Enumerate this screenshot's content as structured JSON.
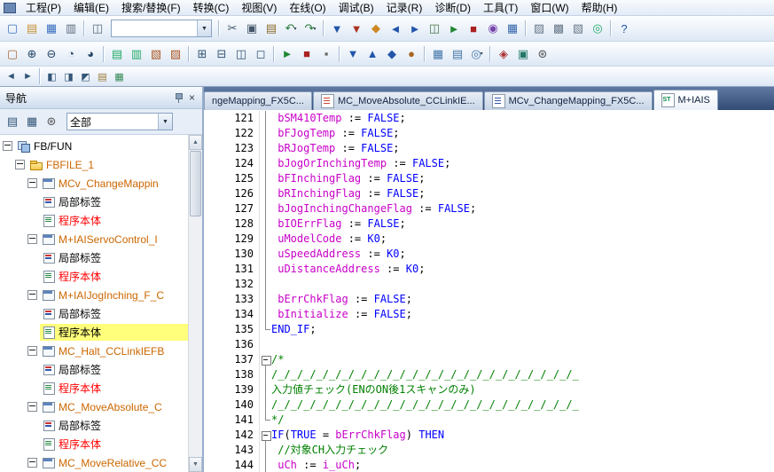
{
  "menubar": {
    "items": [
      "工程(P)",
      "编辑(E)",
      "搜索/替换(F)",
      "转换(C)",
      "视图(V)",
      "在线(O)",
      "调试(B)",
      "记录(R)",
      "诊断(D)",
      "工具(T)",
      "窗口(W)",
      "帮助(H)"
    ]
  },
  "toolbar": {
    "row1": [
      {
        "n": "new-project-icon",
        "g": "▢",
        "c": "#3a6ebf"
      },
      {
        "n": "open-project-icon",
        "g": "▤",
        "c": "#c79138"
      },
      {
        "n": "save-project-icon",
        "g": "▦",
        "c": "#3a6ebf"
      },
      {
        "n": "print-icon",
        "g": "▥",
        "c": "#5a6b7d"
      },
      {
        "s": 1
      },
      {
        "n": "window-switch-icon",
        "g": "◫",
        "c": "#5a6b7d"
      },
      {
        "combo": 1,
        "n": "toolbar-combobox",
        "value": ""
      },
      {
        "s": 1
      },
      {
        "n": "cut-icon",
        "g": "✂",
        "c": "#44566a"
      },
      {
        "n": "copy-icon",
        "g": "▣",
        "c": "#44566a"
      },
      {
        "n": "paste-icon",
        "g": "▤",
        "c": "#8a6a2a"
      },
      {
        "n": "undo-icon",
        "g": "↶",
        "c": "#2a7a3a",
        "dd": 1
      },
      {
        "n": "redo-icon",
        "g": "↷",
        "c": "#2a7a3a",
        "dd": 1
      },
      {
        "s": 1
      },
      {
        "n": "convert-icon",
        "g": "▼",
        "c": "#2255aa"
      },
      {
        "n": "convert-all-icon",
        "g": "▼",
        "c": "#aa3322"
      },
      {
        "n": "online-program-change-icon",
        "g": "◆",
        "c": "#cc8822"
      },
      {
        "n": "read-from-plc-icon",
        "g": "◄",
        "c": "#2255aa"
      },
      {
        "n": "write-to-plc-icon",
        "g": "►",
        "c": "#2255aa"
      },
      {
        "n": "verify-with-plc-icon",
        "g": "◫",
        "c": "#447744"
      },
      {
        "n": "monitor-start-icon",
        "g": "►",
        "c": "#228833"
      },
      {
        "n": "monitor-stop-icon",
        "g": "■",
        "c": "#aa2222"
      },
      {
        "n": "device-test-icon",
        "g": "◉",
        "c": "#7744aa"
      },
      {
        "n": "cross-reference-icon",
        "g": "▦",
        "c": "#3366aa"
      },
      {
        "s": 1
      },
      {
        "n": "device-comment-icon",
        "g": "▨",
        "c": "#667788"
      },
      {
        "n": "statement-display-icon",
        "g": "▩",
        "c": "#667788"
      },
      {
        "n": "note-display-icon",
        "g": "▧",
        "c": "#667788"
      },
      {
        "n": "watch-window-icon",
        "g": "◎",
        "c": "#22aa66"
      },
      {
        "s": 1
      },
      {
        "n": "help-icon",
        "g": "?",
        "c": "#2255aa"
      }
    ],
    "row2": [
      {
        "n": "new-data-icon",
        "g": "▢",
        "c": "#aa6633"
      },
      {
        "n": "zoom-in-icon",
        "g": "⊕",
        "c": "#224466"
      },
      {
        "n": "zoom-out-icon",
        "g": "⊖",
        "c": "#224466"
      },
      {
        "n": "find-icon",
        "g": "◔",
        "c": "#224466"
      },
      {
        "n": "replace-icon",
        "g": "◕",
        "c": "#224466"
      },
      {
        "s": 1
      },
      {
        "n": "comment-display-icon",
        "g": "▤",
        "c": "#22aa66"
      },
      {
        "n": "statement-list-icon",
        "g": "▥",
        "c": "#22aa66"
      },
      {
        "n": "device-display-icon",
        "g": "▧",
        "c": "#aa5522"
      },
      {
        "n": "label-display-icon",
        "g": "▨",
        "c": "#aa5522"
      },
      {
        "s": 1
      },
      {
        "n": "insert-row-icon",
        "g": "⊞",
        "c": "#335577"
      },
      {
        "n": "delete-row-icon",
        "g": "⊟",
        "c": "#335577"
      },
      {
        "n": "insert-column-icon",
        "g": "◫",
        "c": "#335577"
      },
      {
        "n": "delete-column-icon",
        "g": "◻",
        "c": "#335577"
      },
      {
        "s": 1
      },
      {
        "n": "simulation-start-icon",
        "g": "►",
        "c": "#228833"
      },
      {
        "n": "simulation-stop-icon",
        "g": "■",
        "c": "#aa2222"
      },
      {
        "n": "step-execution-icon",
        "g": "▪",
        "c": "#666666"
      },
      {
        "s": 1
      },
      {
        "n": "download-icon",
        "g": "▼",
        "c": "#2255aa"
      },
      {
        "n": "upload-icon",
        "g": "▲",
        "c": "#2255aa"
      },
      {
        "n": "online-verify-icon",
        "g": "◆",
        "c": "#2255aa"
      },
      {
        "n": "remote-operation-icon",
        "g": "●",
        "c": "#aa6622"
      },
      {
        "s": 1
      },
      {
        "n": "cross-reference-list-icon",
        "g": "▦",
        "c": "#4477aa"
      },
      {
        "n": "device-list-icon",
        "g": "▤",
        "c": "#4477aa"
      },
      {
        "n": "watch-register-icon",
        "g": "◎",
        "c": "#4477aa",
        "dd": 1
      },
      {
        "s": 1
      },
      {
        "n": "module-diagnostics-icon",
        "g": "◈",
        "c": "#aa3333"
      },
      {
        "n": "system-monitor-icon",
        "g": "▣",
        "c": "#227766"
      },
      {
        "n": "options-icon",
        "g": "⊛",
        "c": "#555555"
      }
    ],
    "row3": [
      {
        "n": "back-icon",
        "g": "◄",
        "c": "#335577"
      },
      {
        "n": "forward-icon",
        "g": "►",
        "c": "#335577"
      },
      {
        "s": 1
      },
      {
        "n": "docking-window-icon",
        "g": "◧",
        "c": "#335577"
      },
      {
        "n": "element-selection-icon",
        "g": "◨",
        "c": "#335577"
      },
      {
        "n": "output-window-icon",
        "g": "◩",
        "c": "#335577"
      },
      {
        "n": "bookmark-icon",
        "g": "▤",
        "c": "#997733"
      },
      {
        "n": "find-result-icon",
        "g": "▦",
        "c": "#338855"
      }
    ]
  },
  "navigation": {
    "title": "导航",
    "filter": "全部",
    "tools": [
      {
        "n": "tree-display-order-icon",
        "g": "▤",
        "c": "#335577"
      },
      {
        "n": "tree-display-category-icon",
        "g": "▦",
        "c": "#335577"
      },
      {
        "n": "tree-settings-icon",
        "g": "⊛",
        "c": "#555555"
      }
    ],
    "tree": [
      {
        "label": "FB/FUN",
        "level": 0,
        "icon": "fbfun",
        "exp": true,
        "cls": "t-black"
      },
      {
        "label": "FBFILE_1",
        "level": 1,
        "icon": "folder",
        "exp": true,
        "cls": "t-orange"
      },
      {
        "label": "MCv_ChangeMappin",
        "level": 2,
        "icon": "fb",
        "exp": true,
        "cls": "t-orange"
      },
      {
        "label": "局部标签",
        "level": 3,
        "icon": "label",
        "cls": "t-black"
      },
      {
        "label": "程序本体",
        "level": 3,
        "icon": "prog",
        "cls": "t-red"
      },
      {
        "label": "M+IAIServoControl_I",
        "level": 2,
        "icon": "fb",
        "exp": true,
        "cls": "t-orange"
      },
      {
        "label": "局部标签",
        "level": 3,
        "icon": "label",
        "cls": "t-black"
      },
      {
        "label": "程序本体",
        "level": 3,
        "icon": "prog",
        "cls": "t-red"
      },
      {
        "label": "M+IAIJogInching_F_C",
        "level": 2,
        "icon": "fb",
        "exp": true,
        "cls": "t-orange"
      },
      {
        "label": "局部标签",
        "level": 3,
        "icon": "label",
        "cls": "t-black"
      },
      {
        "label": "程序本体",
        "level": 3,
        "icon": "prog",
        "cls": "t-black",
        "selected": true
      },
      {
        "label": "MC_Halt_CCLinkIEFB",
        "level": 2,
        "icon": "fb",
        "exp": true,
        "cls": "t-orange"
      },
      {
        "label": "局部标签",
        "level": 3,
        "icon": "label",
        "cls": "t-black"
      },
      {
        "label": "程序本体",
        "level": 3,
        "icon": "prog",
        "cls": "t-red"
      },
      {
        "label": "MC_MoveAbsolute_C",
        "level": 2,
        "icon": "fb",
        "exp": true,
        "cls": "t-orange"
      },
      {
        "label": "局部标签",
        "level": 3,
        "icon": "label",
        "cls": "t-black"
      },
      {
        "label": "程序本体",
        "level": 3,
        "icon": "prog",
        "cls": "t-red"
      },
      {
        "label": "MC_MoveRelative_CC",
        "level": 2,
        "icon": "fb",
        "exp": true,
        "cls": "t-orange"
      }
    ]
  },
  "tabs": [
    {
      "label": "ngeMapping_FX5C...",
      "icon": "none",
      "active": false
    },
    {
      "label": "MC_MoveAbsolute_CCLinkIE...",
      "icon": "red",
      "active": false
    },
    {
      "label": "MCv_ChangeMapping_FX5C...",
      "icon": "blue",
      "active": false
    },
    {
      "label": "M+IAIS",
      "icon": "st",
      "active": true
    }
  ],
  "editor": {
    "lines": [
      {
        "num": 121,
        "fold": "mid",
        "seg": [
          [
            "p",
            " "
          ],
          [
            "v",
            "bSM410Temp"
          ],
          [
            "p",
            " := "
          ],
          [
            "k",
            "FALSE"
          ],
          [
            "p",
            ";"
          ]
        ]
      },
      {
        "num": 122,
        "fold": "mid",
        "seg": [
          [
            "p",
            " "
          ],
          [
            "v",
            "bFJogTemp"
          ],
          [
            "p",
            " := "
          ],
          [
            "k",
            "FALSE"
          ],
          [
            "p",
            ";"
          ]
        ]
      },
      {
        "num": 123,
        "fold": "mid",
        "seg": [
          [
            "p",
            " "
          ],
          [
            "v",
            "bRJogTemp"
          ],
          [
            "p",
            " := "
          ],
          [
            "k",
            "FALSE"
          ],
          [
            "p",
            ";"
          ]
        ]
      },
      {
        "num": 124,
        "fold": "mid",
        "seg": [
          [
            "p",
            " "
          ],
          [
            "v",
            "bJogOrInchingTemp"
          ],
          [
            "p",
            " := "
          ],
          [
            "k",
            "FALSE"
          ],
          [
            "p",
            ";"
          ]
        ]
      },
      {
        "num": 125,
        "fold": "mid",
        "seg": [
          [
            "p",
            " "
          ],
          [
            "v",
            "bFInchingFlag"
          ],
          [
            "p",
            " := "
          ],
          [
            "k",
            "FALSE"
          ],
          [
            "p",
            ";"
          ]
        ]
      },
      {
        "num": 126,
        "fold": "mid",
        "seg": [
          [
            "p",
            " "
          ],
          [
            "v",
            "bRInchingFlag"
          ],
          [
            "p",
            " := "
          ],
          [
            "k",
            "FALSE"
          ],
          [
            "p",
            ";"
          ]
        ]
      },
      {
        "num": 127,
        "fold": "mid",
        "seg": [
          [
            "p",
            " "
          ],
          [
            "v",
            "bJogInchingChangeFlag"
          ],
          [
            "p",
            " := "
          ],
          [
            "k",
            "FALSE"
          ],
          [
            "p",
            ";"
          ]
        ]
      },
      {
        "num": 128,
        "fold": "mid",
        "seg": [
          [
            "p",
            " "
          ],
          [
            "v",
            "bIOErrFlag"
          ],
          [
            "p",
            " := "
          ],
          [
            "k",
            "FALSE"
          ],
          [
            "p",
            ";"
          ]
        ]
      },
      {
        "num": 129,
        "fold": "mid",
        "seg": [
          [
            "p",
            " "
          ],
          [
            "v",
            "uModelCode"
          ],
          [
            "p",
            " := "
          ],
          [
            "k",
            "K0"
          ],
          [
            "p",
            ";"
          ]
        ]
      },
      {
        "num": 130,
        "fold": "mid",
        "seg": [
          [
            "p",
            " "
          ],
          [
            "v",
            "uSpeedAddress"
          ],
          [
            "p",
            " := "
          ],
          [
            "k",
            "K0"
          ],
          [
            "p",
            ";"
          ]
        ]
      },
      {
        "num": 131,
        "fold": "mid",
        "seg": [
          [
            "p",
            " "
          ],
          [
            "v",
            "uDistanceAddress"
          ],
          [
            "p",
            " := "
          ],
          [
            "k",
            "K0"
          ],
          [
            "p",
            ";"
          ]
        ]
      },
      {
        "num": 132,
        "fold": "mid",
        "seg": []
      },
      {
        "num": 133,
        "fold": "mid",
        "seg": [
          [
            "p",
            " "
          ],
          [
            "v",
            "bErrChkFlag"
          ],
          [
            "p",
            " := "
          ],
          [
            "k",
            "FALSE"
          ],
          [
            "p",
            ";"
          ]
        ]
      },
      {
        "num": 134,
        "fold": "mid",
        "seg": [
          [
            "p",
            " "
          ],
          [
            "v",
            "bInitialize"
          ],
          [
            "p",
            " := "
          ],
          [
            "k",
            "FALSE"
          ],
          [
            "p",
            ";"
          ]
        ]
      },
      {
        "num": 135,
        "fold": "end",
        "seg": [
          [
            "k",
            "END_IF"
          ],
          [
            "p",
            ";"
          ]
        ]
      },
      {
        "num": 136,
        "fold": "",
        "seg": []
      },
      {
        "num": 137,
        "fold": "box",
        "seg": [
          [
            "c",
            "/*"
          ]
        ]
      },
      {
        "num": 138,
        "fold": "mid",
        "seg": [
          [
            "c",
            "/_/_/_/_/_/_/_/_/_/_/_/_/_/_/_/_/_/_/_/_/_/_/_/_"
          ]
        ]
      },
      {
        "num": 139,
        "fold": "mid",
        "seg": [
          [
            "c",
            "入力値チェック(ENのON後1スキャンのみ)"
          ]
        ]
      },
      {
        "num": 140,
        "fold": "mid",
        "seg": [
          [
            "c",
            "/_/_/_/_/_/_/_/_/_/_/_/_/_/_/_/_/_/_/_/_/_/_/_/_"
          ]
        ]
      },
      {
        "num": 141,
        "fold": "end",
        "seg": [
          [
            "c",
            "*/"
          ]
        ]
      },
      {
        "num": 142,
        "fold": "box",
        "seg": [
          [
            "k",
            "IF"
          ],
          [
            "p",
            "("
          ],
          [
            "k",
            "TRUE"
          ],
          [
            "p",
            " = "
          ],
          [
            "v",
            "bErrChkFlag"
          ],
          [
            "p",
            ") "
          ],
          [
            "k",
            "THEN"
          ]
        ]
      },
      {
        "num": 143,
        "fold": "mid",
        "seg": [
          [
            "p",
            " "
          ],
          [
            "c",
            "//対象CH入力チェック"
          ]
        ]
      },
      {
        "num": 144,
        "fold": "mid",
        "seg": [
          [
            "p",
            " "
          ],
          [
            "v",
            "uCh"
          ],
          [
            "p",
            " := "
          ],
          [
            "v",
            "i_uCh"
          ],
          [
            "p",
            ";"
          ]
        ]
      }
    ]
  },
  "colors": {
    "keyword": "#0000ff",
    "variable": "#c800c8",
    "comment": "#008000",
    "tree-modified": "#cc6600",
    "tree-unconverted": "#ff0000",
    "selection": "#ffff7c",
    "tabbar": "#3c5c8f"
  }
}
